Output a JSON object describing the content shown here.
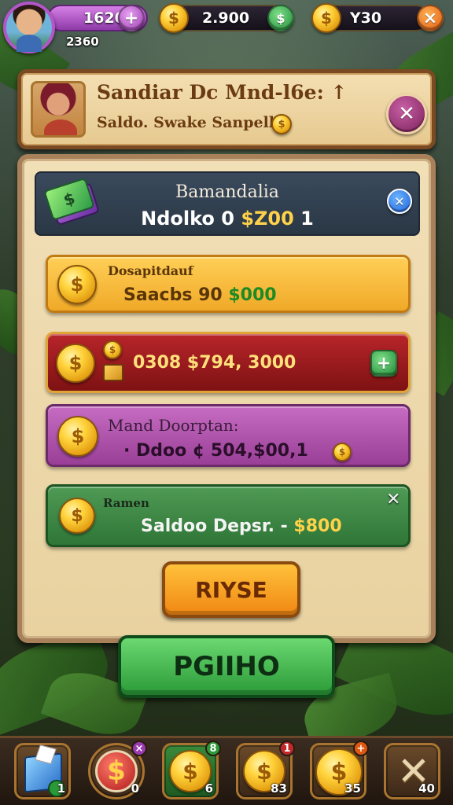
{
  "hud": {
    "level_value": "1620",
    "level_button": "+",
    "sub_value": "2360",
    "coins_value": "2.900",
    "gems_value": "Y30",
    "coin_symbol": "$",
    "gem_button": "×"
  },
  "header": {
    "title": "Sandiar Dc Mnd-l6e: ↑",
    "subtitle": "Saldo. Swake Sanpell",
    "close": "✕"
  },
  "panel": {
    "top_title": "Bamandalia",
    "top_amount_prefix": "Ndolko 0",
    "top_amount_gold": "$Z00",
    "top_amount_suffix": " 1",
    "top_close": "✕",
    "rows": [
      {
        "label": "Dosapitdauf",
        "value_prefix": "Saacbs   90",
        "value_green": " $000"
      },
      {
        "label": "",
        "value": "0308  $794, 3000",
        "button": "+"
      },
      {
        "label": "Mand Doorptan:",
        "value": "· Ddoo  ¢ 504,$00,1"
      },
      {
        "label": "Ramen",
        "value_prefix": "Saldoo Depsr. - ",
        "value_gold": "$800",
        "close": "✕"
      }
    ],
    "orange_button": "RIYSE"
  },
  "main_button": "PGIIHO",
  "bottom": {
    "slots": [
      {
        "count": "1"
      },
      {
        "count": "0",
        "badge": "×"
      },
      {
        "count": "6",
        "badge": "8"
      },
      {
        "count": "83",
        "badge": "1"
      },
      {
        "count": "35",
        "badge": "+"
      },
      {
        "count": "40"
      }
    ]
  },
  "colors": {
    "accent_purple": "#b256c9",
    "panel_brown": "#7a4a22",
    "gold": "#ffd24a",
    "green_button": "#2a9a38",
    "orange_button": "#f08713"
  }
}
